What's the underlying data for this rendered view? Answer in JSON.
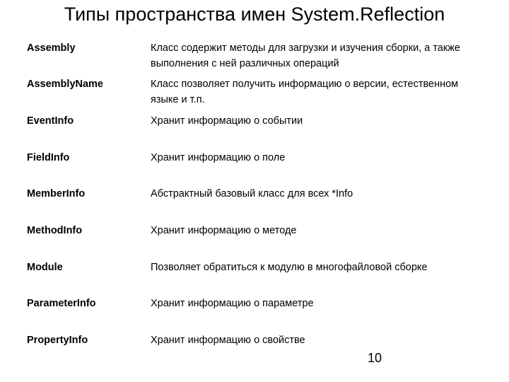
{
  "slide": {
    "title": "Типы пространства имен System.Reflection",
    "rows": [
      {
        "term": "Assembly",
        "description": "Класс содержит методы для загрузки и изучения сборки, а также выполнения с ней различных операций"
      },
      {
        "term": "AssemblyName",
        "description": "Класс позволяет получить информацию о версии, естественном языке и т.п."
      },
      {
        "term": "EventInfo",
        "description": "Хранит информацию о событии"
      },
      {
        "term": "FieldInfo",
        "description": "Хранит информацию о поле"
      },
      {
        "term": "MemberInfo",
        "description": "Абстрактный базовый класс для всех *Info"
      },
      {
        "term": "MethodInfo",
        "description": "Хранит информацию о методе"
      },
      {
        "term": "Module",
        "description": "Позволяет обратиться к модулю в многофайловой сборке"
      },
      {
        "term": "ParameterInfo",
        "description": "Хранит информацию о параметре"
      },
      {
        "term": "PropertyInfo",
        "description": "Хранит информацию о свойстве"
      }
    ],
    "page_number": "10"
  }
}
